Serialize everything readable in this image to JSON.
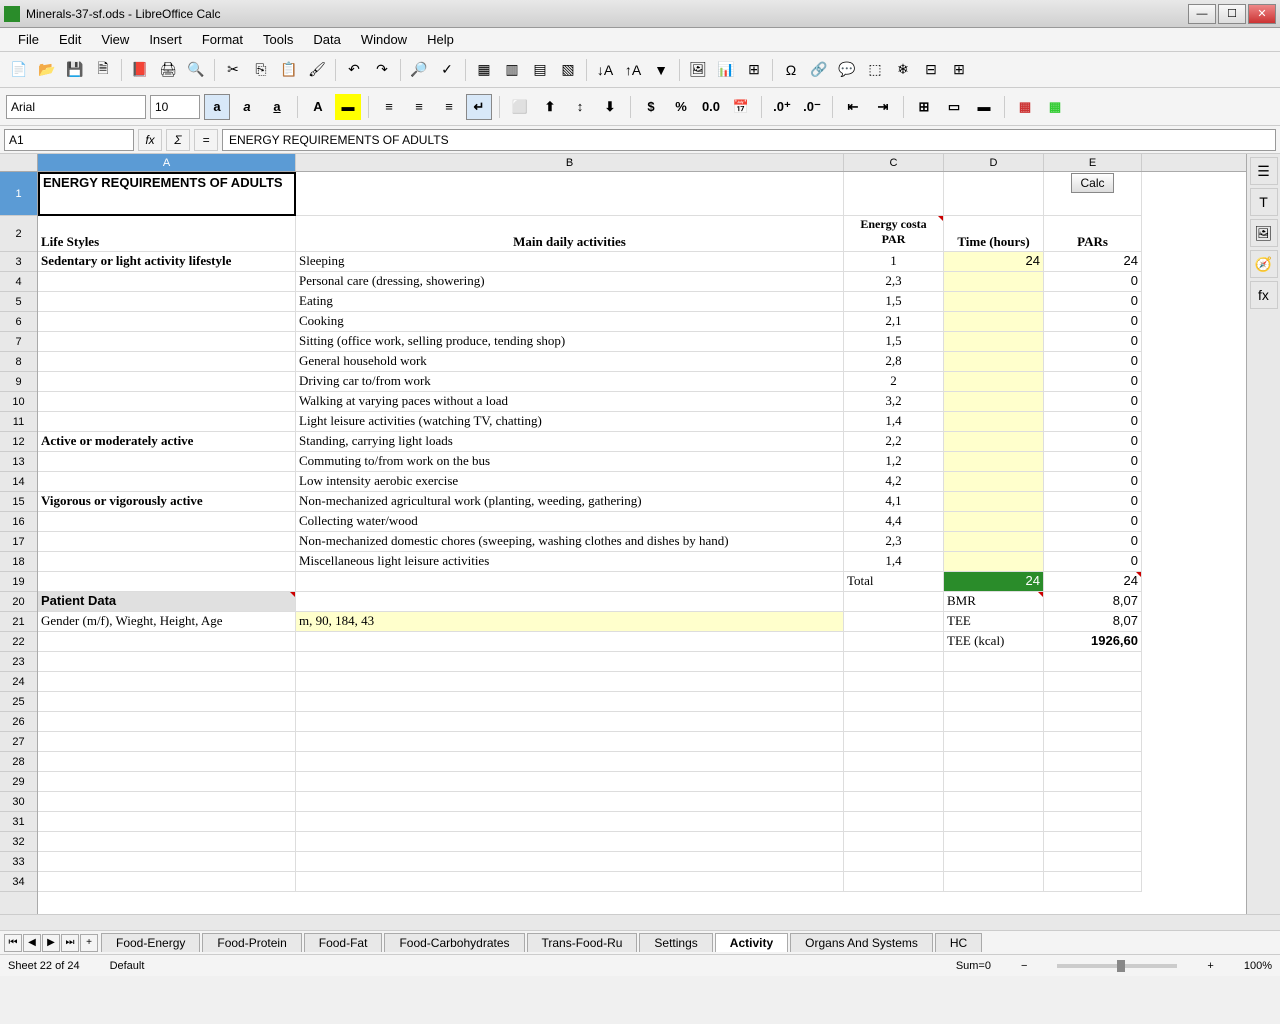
{
  "title": "Minerals-37-sf.ods - LibreOffice Calc",
  "menus": [
    "File",
    "Edit",
    "View",
    "Insert",
    "Format",
    "Tools",
    "Data",
    "Window",
    "Help"
  ],
  "font": {
    "name": "Arial",
    "size": "10"
  },
  "cellref": "A1",
  "formula": "ENERGY REQUIREMENTS OF ADULTS",
  "columns": [
    "A",
    "B",
    "C",
    "D",
    "E"
  ],
  "headers": {
    "A2": "Life Styles",
    "B2": "Main daily activities",
    "C2": "Energy costa PAR",
    "D2": "Time (hours)",
    "E2": "PARs"
  },
  "A1": "ENERGY REQUIREMENTS OF ADULTS",
  "E1_btn": "Calc",
  "rows": [
    {
      "A": "Sedentary or light activity lifestyle",
      "B": "Sleeping",
      "C": "1",
      "D": "24",
      "E": "24"
    },
    {
      "A": "",
      "B": "Personal care (dressing, showering)",
      "C": "2,3",
      "D": "",
      "E": "0"
    },
    {
      "A": "",
      "B": "Eating",
      "C": "1,5",
      "D": "",
      "E": "0"
    },
    {
      "A": "",
      "B": "Cooking",
      "C": "2,1",
      "D": "",
      "E": "0"
    },
    {
      "A": "",
      "B": "Sitting (office work, selling produce, tending shop)",
      "C": "1,5",
      "D": "",
      "E": "0"
    },
    {
      "A": "",
      "B": "General household work",
      "C": "2,8",
      "D": "",
      "E": "0"
    },
    {
      "A": "",
      "B": "Driving car to/from work",
      "C": "2",
      "D": "",
      "E": "0"
    },
    {
      "A": "",
      "B": "Walking at varying paces without a load",
      "C": "3,2",
      "D": "",
      "E": "0"
    },
    {
      "A": "",
      "B": "Light leisure activities (watching TV, chatting)",
      "C": "1,4",
      "D": "",
      "E": "0"
    },
    {
      "A": "Active or moderately active",
      "B": "Standing, carrying light loads",
      "C": "2,2",
      "D": "",
      "E": "0"
    },
    {
      "A": "",
      "B": "Commuting to/from work on the bus",
      "C": "1,2",
      "D": "",
      "E": "0"
    },
    {
      "A": "",
      "B": "Low intensity aerobic exercise",
      "C": "4,2",
      "D": "",
      "E": "0"
    },
    {
      "A": "Vigorous or vigorously active",
      "B": "Non-mechanized agricultural work (planting, weeding, gathering)",
      "C": "4,1",
      "D": "",
      "E": "0"
    },
    {
      "A": "",
      "B": "Collecting water/wood",
      "C": "4,4",
      "D": "",
      "E": "0"
    },
    {
      "A": "",
      "B": "Non-mechanized domestic chores (sweeping, washing clothes and dishes by hand)",
      "C": "2,3",
      "D": "",
      "E": "0"
    },
    {
      "A": "",
      "B": "Miscellaneous light leisure activities",
      "C": "1,4",
      "D": "",
      "E": "0"
    }
  ],
  "total_row": {
    "C": "Total",
    "D": "24",
    "E": "24"
  },
  "patient": {
    "header": "Patient Data",
    "label": "Gender (m/f), Wieght, Height, Age",
    "value": "m, 90, 184, 43"
  },
  "results": {
    "bmr_label": "BMR",
    "bmr": "8,07",
    "tee_label": "TEE",
    "tee": "8,07",
    "teek_label": "TEE (kcal)",
    "teek": "1926,60"
  },
  "tabs": [
    "Food-Energy",
    "Food-Protein",
    "Food-Fat",
    "Food-Carbohydrates",
    "Trans-Food-Ru",
    "Settings",
    "Activity",
    "Organs And Systems",
    "HC"
  ],
  "active_tab": "Activity",
  "status": {
    "sheet": "Sheet 22 of 24",
    "style": "Default",
    "sum": "Sum=0",
    "zoom": "100%"
  }
}
